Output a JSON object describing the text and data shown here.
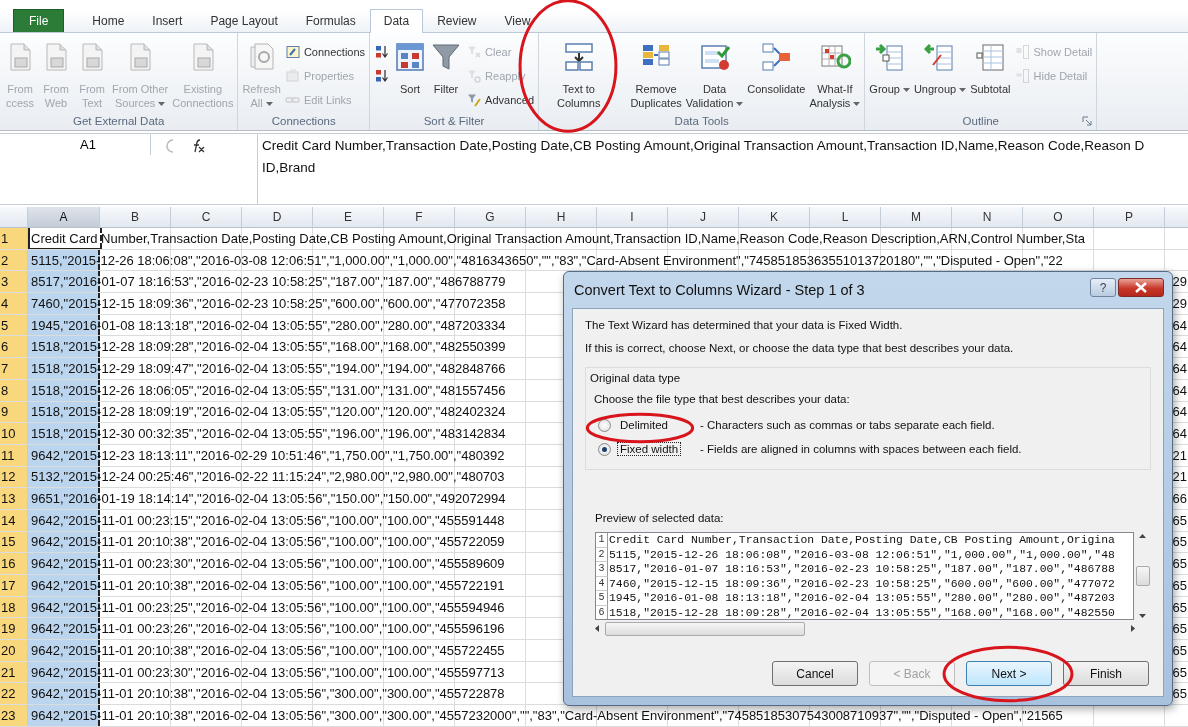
{
  "tabs": [
    {
      "label": "File",
      "kind": "file",
      "selected": false
    },
    {
      "label": "Home",
      "kind": "tab",
      "selected": false
    },
    {
      "label": "Insert",
      "kind": "tab",
      "selected": false
    },
    {
      "label": "Page Layout",
      "kind": "tab",
      "selected": false
    },
    {
      "label": "Formulas",
      "kind": "tab",
      "selected": false
    },
    {
      "label": "Data",
      "kind": "tab",
      "selected": true
    },
    {
      "label": "Review",
      "kind": "tab",
      "selected": false
    },
    {
      "label": "View",
      "kind": "tab",
      "selected": false
    }
  ],
  "ribbon": {
    "groups": [
      {
        "label": "Get External Data",
        "launcher": false,
        "items": [
          {
            "kind": "large",
            "lines": [
              "From",
              "ccess"
            ],
            "disabled": true,
            "dropdown": false
          },
          {
            "kind": "large",
            "lines": [
              "From",
              "Web"
            ],
            "disabled": true,
            "dropdown": false
          },
          {
            "kind": "large",
            "lines": [
              "From",
              "Text"
            ],
            "disabled": true,
            "dropdown": false
          },
          {
            "kind": "large",
            "lines": [
              "From Other",
              "Sources"
            ],
            "disabled": true,
            "dropdown": true
          },
          {
            "kind": "large",
            "lines": [
              "Existing",
              "Connections"
            ],
            "disabled": true,
            "dropdown": false
          }
        ]
      },
      {
        "label": "Connections",
        "launcher": false,
        "items": [
          {
            "kind": "large",
            "lines": [
              "Refresh",
              "All"
            ],
            "disabled": true,
            "dropdown": true
          },
          {
            "kind": "stack",
            "buttons": [
              {
                "label": "Connections",
                "disabled": false
              },
              {
                "label": "Properties",
                "disabled": true
              },
              {
                "label": "Edit Links",
                "disabled": true
              }
            ]
          }
        ]
      },
      {
        "label": "Sort & Filter",
        "launcher": false,
        "items": [
          {
            "kind": "stack",
            "buttons": [
              {
                "disabled": false
              },
              {
                "disabled": false
              }
            ]
          },
          {
            "kind": "large",
            "lines": [
              "Sort"
            ],
            "disabled": false,
            "dropdown": false
          },
          {
            "kind": "large",
            "lines": [
              "Filter"
            ],
            "disabled": false,
            "dropdown": false
          },
          {
            "kind": "stack",
            "buttons": [
              {
                "label": "Clear",
                "disabled": true
              },
              {
                "label": "Reapply",
                "disabled": true
              },
              {
                "label": "Advanced",
                "disabled": false
              }
            ]
          }
        ]
      },
      {
        "label": "Data Tools",
        "launcher": false,
        "items": [
          {
            "kind": "large",
            "lines": [
              "Text to",
              "Columns"
            ],
            "disabled": false,
            "dropdown": false
          },
          {
            "kind": "large",
            "lines": [
              "Remove",
              "Duplicates"
            ],
            "disabled": false,
            "dropdown": false
          },
          {
            "kind": "large",
            "lines": [
              "Data",
              "Validation"
            ],
            "disabled": false,
            "dropdown": true
          },
          {
            "kind": "large",
            "lines": [
              "Consolidate"
            ],
            "disabled": false,
            "dropdown": false
          },
          {
            "kind": "large",
            "lines": [
              "What-If",
              "Analysis"
            ],
            "disabled": false,
            "dropdown": true
          }
        ]
      },
      {
        "label": "Outline",
        "launcher": true,
        "items": [
          {
            "kind": "large",
            "lines": [
              "Group"
            ],
            "disabled": false,
            "dropdown": true
          },
          {
            "kind": "large",
            "lines": [
              "Ungroup"
            ],
            "disabled": false,
            "dropdown": true
          },
          {
            "kind": "large",
            "lines": [
              "Subtotal"
            ],
            "disabled": false,
            "dropdown": false
          },
          {
            "kind": "stack",
            "buttons": [
              {
                "label": "Show Detail",
                "disabled": true
              },
              {
                "label": "Hide Detail",
                "disabled": true
              }
            ]
          }
        ]
      }
    ]
  },
  "formula_bar": {
    "name_box": "A1",
    "lines": [
      "Credit Card Number,Transaction Date,Posting Date,CB Posting Amount,Original Transaction Amount,Transaction ID,Name,Reason Code,Reason D",
      "ID,Brand"
    ]
  },
  "sheet": {
    "columns": [
      {
        "label": "A",
        "selected": true
      },
      {
        "label": "B",
        "selected": false
      },
      {
        "label": "C",
        "selected": false
      },
      {
        "label": "D",
        "selected": false
      },
      {
        "label": "E",
        "selected": false
      },
      {
        "label": "F",
        "selected": false
      },
      {
        "label": "G",
        "selected": false
      },
      {
        "label": "H",
        "selected": false
      },
      {
        "label": "I",
        "selected": false
      },
      {
        "label": "J",
        "selected": false
      },
      {
        "label": "K",
        "selected": false
      },
      {
        "label": "L",
        "selected": false
      },
      {
        "label": "M",
        "selected": false
      },
      {
        "label": "N",
        "selected": false
      },
      {
        "label": "O",
        "selected": false
      },
      {
        "label": "P",
        "selected": false
      }
    ],
    "rows": [
      {
        "number": "1",
        "selected": true,
        "active": true,
        "text": "Credit Card Number,Transaction Date,Posting Date,CB Posting Amount,Original Transaction Amount,Transaction ID,Name,Reason Code,Reason Description,ARN,Control Number,Sta"
      },
      {
        "number": "2",
        "selected": true,
        "active": false,
        "text": "5115,\"2015-12-26 18:06:08\",\"2016-03-08 12:06:51\",\"1,000.00\",\"1,000.00\",\"4816343650\",\"\",\"83\",\"Card-Absent Environment\",\"74585185363551013720180\",\"\",\"Disputed - Open\",\"22"
      },
      {
        "number": "3",
        "selected": true,
        "active": false,
        "text": "8517,\"2016-01-07 18:16:53\",\"2016-02-23 10:58:25\",\"187.00\",\"187.00\",\"486788779",
        "edge": "29"
      },
      {
        "number": "4",
        "selected": true,
        "active": false,
        "text": "7460,\"2015-12-15 18:09:36\",\"2016-02-23 10:58:25\",\"600.00\",\"600.00\",\"477072358",
        "edge": "29"
      },
      {
        "number": "5",
        "selected": true,
        "active": false,
        "text": "1945,\"2016-01-08 18:13:18\",\"2016-02-04 13:05:55\",\"280.00\",\"280.00\",\"487203334",
        "edge": "64"
      },
      {
        "number": "6",
        "selected": true,
        "active": false,
        "text": "1518,\"2015-12-28 18:09:28\",\"2016-02-04 13:05:55\",\"168.00\",\"168.00\",\"482550399",
        "edge": "64"
      },
      {
        "number": "7",
        "selected": true,
        "active": false,
        "text": "1518,\"2015-12-29 18:09:47\",\"2016-02-04 13:05:55\",\"194.00\",\"194.00\",\"482848766",
        "edge": "64"
      },
      {
        "number": "8",
        "selected": true,
        "active": false,
        "text": "1518,\"2015-12-26 18:06:05\",\"2016-02-04 13:05:55\",\"131.00\",\"131.00\",\"481557456",
        "edge": "64"
      },
      {
        "number": "9",
        "selected": true,
        "active": false,
        "text": "1518,\"2015-12-28 18:09:19\",\"2016-02-04 13:05:55\",\"120.00\",\"120.00\",\"482402324",
        "edge": "64"
      },
      {
        "number": "10",
        "selected": true,
        "active": false,
        "text": "1518,\"2015-12-30 00:32:35\",\"2016-02-04 13:05:55\",\"196.00\",\"196.00\",\"483142834",
        "edge": "64"
      },
      {
        "number": "11",
        "selected": true,
        "active": false,
        "text": "9642,\"2015-12-23 18:13:11\",\"2016-02-29 10:51:46\",\"1,750.00\",\"1,750.00\",\"480392",
        "edge": "21"
      },
      {
        "number": "12",
        "selected": true,
        "active": false,
        "text": "5132,\"2015-12-24 00:25:46\",\"2016-02-22 11:15:24\",\"2,980.00\",\"2,980.00\",\"480703",
        "edge": "21"
      },
      {
        "number": "13",
        "selected": true,
        "active": false,
        "text": "9651,\"2016-01-19 18:14:14\",\"2016-02-04 13:05:56\",\"150.00\",\"150.00\",\"492072994",
        "edge": "66"
      },
      {
        "number": "14",
        "selected": true,
        "active": false,
        "text": "9642,\"2015-11-01 00:23:15\",\"2016-02-04 13:05:56\",\"100.00\",\"100.00\",\"455591448",
        "edge": "65"
      },
      {
        "number": "15",
        "selected": true,
        "active": false,
        "text": "9642,\"2015-11-01 20:10:38\",\"2016-02-04 13:05:56\",\"100.00\",\"100.00\",\"455722059",
        "edge": "65"
      },
      {
        "number": "16",
        "selected": true,
        "active": false,
        "text": "9642,\"2015-11-01 00:23:30\",\"2016-02-04 13:05:56\",\"100.00\",\"100.00\",\"455589609",
        "edge": "65"
      },
      {
        "number": "17",
        "selected": true,
        "active": false,
        "text": "9642,\"2015-11-01 20:10:38\",\"2016-02-04 13:05:56\",\"100.00\",\"100.00\",\"455722191",
        "edge": "65"
      },
      {
        "number": "18",
        "selected": true,
        "active": false,
        "text": "9642,\"2015-11-01 00:23:25\",\"2016-02-04 13:05:56\",\"100.00\",\"100.00\",\"455594946",
        "edge": "65"
      },
      {
        "number": "19",
        "selected": true,
        "active": false,
        "text": "9642,\"2015-11-01 00:23:26\",\"2016-02-04 13:05:56\",\"100.00\",\"100.00\",\"455596196",
        "edge": "65"
      },
      {
        "number": "20",
        "selected": true,
        "active": false,
        "text": "9642,\"2015-11-01 20:10:38\",\"2016-02-04 13:05:56\",\"100.00\",\"100.00\",\"455722455",
        "edge": "65"
      },
      {
        "number": "21",
        "selected": true,
        "active": false,
        "text": "9642,\"2015-11-01 00:23:30\",\"2016-02-04 13:05:56\",\"100.00\",\"100.00\",\"455597713",
        "edge": "65"
      },
      {
        "number": "22",
        "selected": true,
        "active": false,
        "text": "9642,\"2015-11-01 20:10:38\",\"2016-02-04 13:05:56\",\"300.00\",\"300.00\",\"455722878",
        "edge": "65"
      },
      {
        "number": "23",
        "selected": true,
        "active": false,
        "text": "9642,\"2015-11-01 20:10:38\",\"2016-02-04 13:05:56\",\"300.00\",\"300.00\",\"4557232000\",\"\",\"83\",\"Card-Absent Environment\",\"74585185307543008710937\",\"\",\"Disputed - Open\",\"21565"
      }
    ]
  },
  "dialog": {
    "title": "Convert Text to Columns Wizard - Step 1 of 3",
    "help": "?",
    "intro": [
      "The Text Wizard has determined that your data is Fixed Width.",
      "If this is correct, choose Next, or choose the data type that best describes your data."
    ],
    "group_label": "Original data type",
    "prompt": "Choose the file type that best describes your data:",
    "options": [
      {
        "label": "Delimited",
        "description": "- Characters such as commas or tabs separate each field.",
        "selected": false,
        "focused": false
      },
      {
        "label": "Fixed width",
        "description": "- Fields are aligned in columns with spaces between each field.",
        "selected": true,
        "focused": true
      }
    ],
    "preview_label": "Preview of selected data:",
    "preview": [
      {
        "number": "1",
        "text": "Credit Card Number,Transaction Date,Posting Date,CB Posting Amount,Origina"
      },
      {
        "number": "2",
        "text": "5115,\"2015-12-26 18:06:08\",\"2016-03-08 12:06:51\",\"1,000.00\",\"1,000.00\",\"48"
      },
      {
        "number": "3",
        "text": "8517,\"2016-01-07 18:16:53\",\"2016-02-23 10:58:25\",\"187.00\",\"187.00\",\"486788"
      },
      {
        "number": "4",
        "text": "7460,\"2015-12-15 18:09:36\",\"2016-02-23 10:58:25\",\"600.00\",\"600.00\",\"477072"
      },
      {
        "number": "5",
        "text": "1945,\"2016-01-08 18:13:18\",\"2016-02-04 13:05:55\",\"280.00\",\"280.00\",\"487203"
      },
      {
        "number": "6",
        "text": "1518,\"2015-12-28 18:09:28\",\"2016-02-04 13:05:55\",\"168.00\",\"168.00\",\"482550"
      }
    ],
    "buttons": [
      {
        "label": "Cancel",
        "disabled": false,
        "default": false
      },
      {
        "label": "< Back",
        "disabled": true,
        "default": false
      },
      {
        "label": "Next >",
        "disabled": false,
        "default": true
      },
      {
        "label": "Finish",
        "disabled": false,
        "default": false
      }
    ]
  },
  "annotations": [
    {
      "kind": "ellipse"
    },
    {
      "kind": "ellipse"
    },
    {
      "kind": "ellipse"
    }
  ]
}
